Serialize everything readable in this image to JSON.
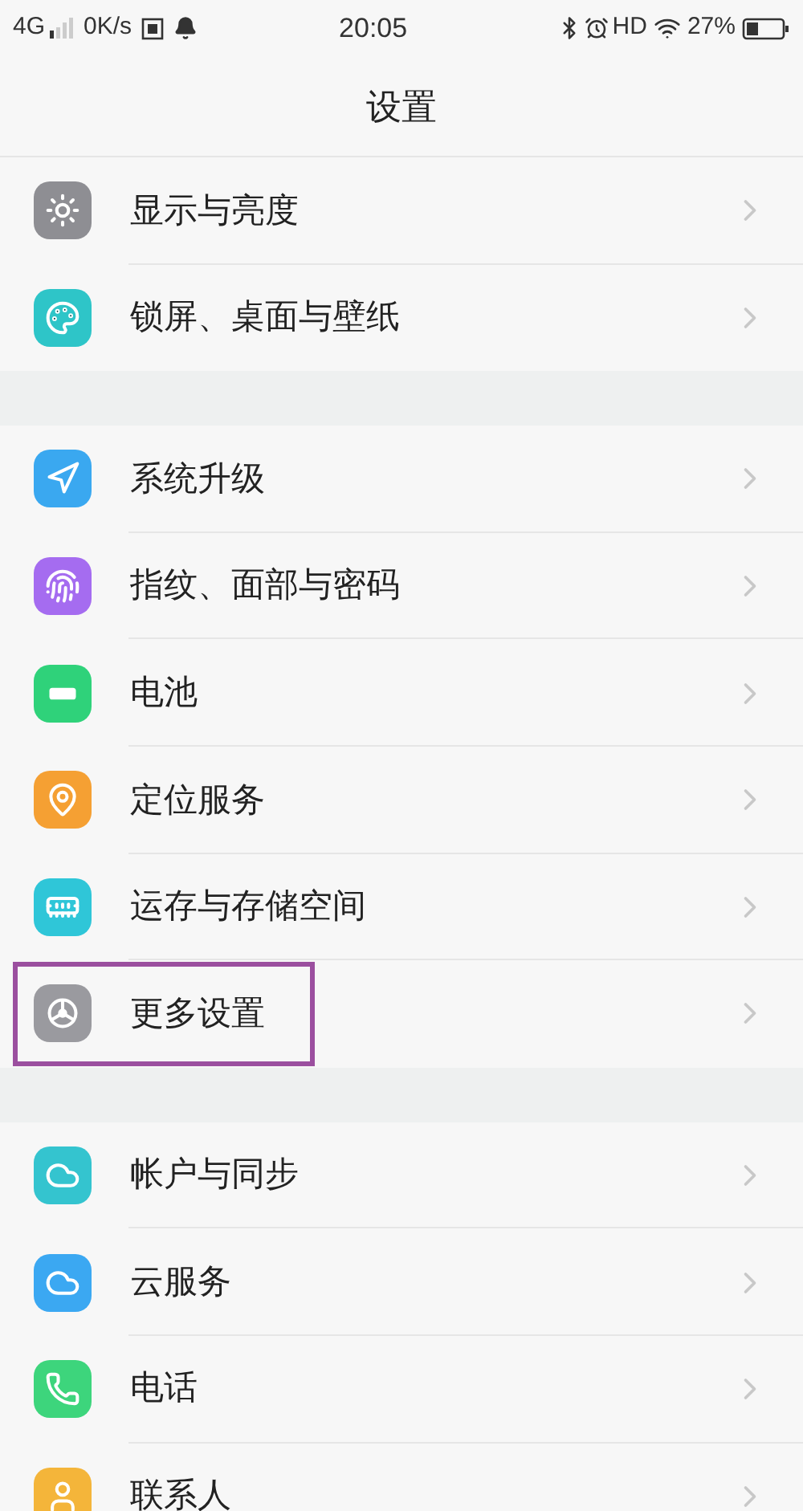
{
  "status_bar": {
    "network": "4G",
    "speed": "0K/s",
    "time": "20:05",
    "hd": "HD",
    "battery": "27%"
  },
  "title": "设置",
  "sections": [
    {
      "items": [
        {
          "label": "显示与亮度",
          "color": "#8e8e93",
          "highlighted": false
        },
        {
          "label": "锁屏、桌面与壁纸",
          "color": "#2ec5c8",
          "highlighted": false
        }
      ]
    },
    {
      "items": [
        {
          "label": "系统升级",
          "color": "#3aa8f0",
          "highlighted": false
        },
        {
          "label": "指纹、面部与密码",
          "color": "#a56cf0",
          "highlighted": false
        },
        {
          "label": "电池",
          "color": "#2fd27a",
          "highlighted": false
        },
        {
          "label": "定位服务",
          "color": "#f5a033",
          "highlighted": false
        },
        {
          "label": "运存与存储空间",
          "color": "#2fc6d8",
          "highlighted": false
        },
        {
          "label": "更多设置",
          "color": "#9a9a9f",
          "highlighted": true
        }
      ]
    },
    {
      "items": [
        {
          "label": "帐户与同步",
          "color": "#34c4cf",
          "highlighted": false
        },
        {
          "label": "云服务",
          "color": "#3ba8f2",
          "highlighted": false
        },
        {
          "label": "电话",
          "color": "#3dd57c",
          "highlighted": false
        },
        {
          "label": "联系人",
          "color": "#f4b53a",
          "highlighted": false
        }
      ]
    }
  ]
}
